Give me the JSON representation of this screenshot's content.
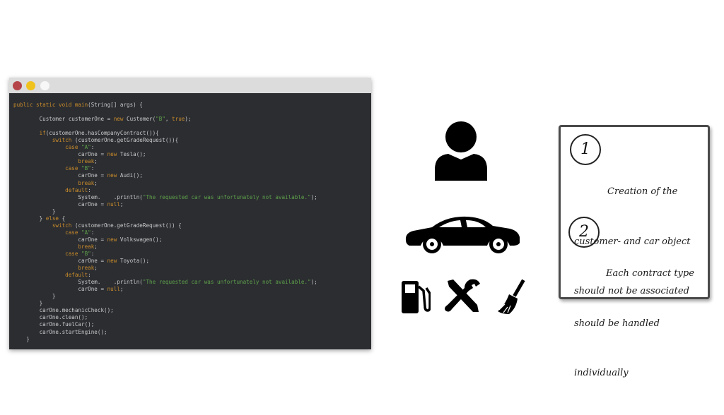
{
  "code_window": {
    "lines": [
      [
        {
          "t": "public static void main",
          "k": "kw"
        },
        {
          "t": "(String[] args) {",
          "k": "plain"
        }
      ],
      [],
      [
        {
          "t": "        Customer customerOne = ",
          "k": "plain"
        },
        {
          "t": "new",
          "k": "kw"
        },
        {
          "t": " Customer(",
          "k": "plain"
        },
        {
          "t": "\"B\"",
          "k": "str"
        },
        {
          "t": ", ",
          "k": "plain"
        },
        {
          "t": "true",
          "k": "kw"
        },
        {
          "t": ");",
          "k": "plain"
        }
      ],
      [],
      [
        {
          "t": "        if",
          "k": "kw"
        },
        {
          "t": "(customerOne.hasCompanyContract()){",
          "k": "plain"
        }
      ],
      [
        {
          "t": "            switch",
          "k": "kw"
        },
        {
          "t": " (customerOne.getGradeRequest()){",
          "k": "plain"
        }
      ],
      [
        {
          "t": "                case ",
          "k": "kw"
        },
        {
          "t": "\"A\"",
          "k": "str"
        },
        {
          "t": ":",
          "k": "plain"
        }
      ],
      [
        {
          "t": "                    carOne = ",
          "k": "plain"
        },
        {
          "t": "new",
          "k": "kw"
        },
        {
          "t": " Tesla();",
          "k": "plain"
        }
      ],
      [
        {
          "t": "                    break",
          "k": "kw"
        },
        {
          "t": ";",
          "k": "plain"
        }
      ],
      [
        {
          "t": "                case ",
          "k": "kw"
        },
        {
          "t": "\"B\"",
          "k": "str"
        },
        {
          "t": ":",
          "k": "plain"
        }
      ],
      [
        {
          "t": "                    carOne = ",
          "k": "plain"
        },
        {
          "t": "new",
          "k": "kw"
        },
        {
          "t": " Audi();",
          "k": "plain"
        }
      ],
      [
        {
          "t": "                    break",
          "k": "kw"
        },
        {
          "t": ";",
          "k": "plain"
        }
      ],
      [
        {
          "t": "                default",
          "k": "kw"
        },
        {
          "t": ":",
          "k": "plain"
        }
      ],
      [
        {
          "t": "                    System.    .println(",
          "k": "plain"
        },
        {
          "t": "\"The requested car was unfortunately not available.\"",
          "k": "str"
        },
        {
          "t": ");",
          "k": "plain"
        }
      ],
      [
        {
          "t": "                    carOne = ",
          "k": "plain"
        },
        {
          "t": "null",
          "k": "kw"
        },
        {
          "t": ";",
          "k": "plain"
        }
      ],
      [
        {
          "t": "            }",
          "k": "plain"
        }
      ],
      [
        {
          "t": "        } ",
          "k": "plain"
        },
        {
          "t": "else",
          "k": "kw"
        },
        {
          "t": " {",
          "k": "plain"
        }
      ],
      [
        {
          "t": "            switch",
          "k": "kw"
        },
        {
          "t": " (customerOne.getGradeRequest()) {",
          "k": "plain"
        }
      ],
      [
        {
          "t": "                case ",
          "k": "kw"
        },
        {
          "t": "\"A\"",
          "k": "str"
        },
        {
          "t": ":",
          "k": "plain"
        }
      ],
      [
        {
          "t": "                    carOne = ",
          "k": "plain"
        },
        {
          "t": "new",
          "k": "kw"
        },
        {
          "t": " Volkswagen();",
          "k": "plain"
        }
      ],
      [
        {
          "t": "                    break",
          "k": "kw"
        },
        {
          "t": ";",
          "k": "plain"
        }
      ],
      [
        {
          "t": "                case ",
          "k": "kw"
        },
        {
          "t": "\"B\"",
          "k": "str"
        },
        {
          "t": ":",
          "k": "plain"
        }
      ],
      [
        {
          "t": "                    carOne = ",
          "k": "plain"
        },
        {
          "t": "new",
          "k": "kw"
        },
        {
          "t": " Toyota();",
          "k": "plain"
        }
      ],
      [
        {
          "t": "                    break",
          "k": "kw"
        },
        {
          "t": ";",
          "k": "plain"
        }
      ],
      [
        {
          "t": "                default",
          "k": "kw"
        },
        {
          "t": ":",
          "k": "plain"
        }
      ],
      [
        {
          "t": "                    System.    .println(",
          "k": "plain"
        },
        {
          "t": "\"The requested car was unfortunately not available.\"",
          "k": "str"
        },
        {
          "t": ");",
          "k": "plain"
        }
      ],
      [
        {
          "t": "                    carOne = ",
          "k": "plain"
        },
        {
          "t": "null",
          "k": "kw"
        },
        {
          "t": ";",
          "k": "plain"
        }
      ],
      [
        {
          "t": "            }",
          "k": "plain"
        }
      ],
      [
        {
          "t": "        }",
          "k": "plain"
        }
      ],
      [
        {
          "t": "        carOne.mechanicCheck();",
          "k": "plain"
        }
      ],
      [
        {
          "t": "        carOne.clean();",
          "k": "plain"
        }
      ],
      [
        {
          "t": "        carOne.fuelCar();",
          "k": "plain"
        }
      ],
      [
        {
          "t": "        carOne.startEngine();",
          "k": "plain"
        }
      ],
      [
        {
          "t": "    }",
          "k": "plain"
        }
      ]
    ]
  },
  "icons": {
    "user": "user-icon",
    "car": "car-icon",
    "fuel": "fuel-pump-icon",
    "tools": "wrench-screwdriver-icon",
    "broom": "broom-icon"
  },
  "note": {
    "item1": {
      "number": "1",
      "lines": [
        "Creation of the",
        "customer- and car object",
        "should not be associated"
      ]
    },
    "item2": {
      "number": "2",
      "lines": [
        "Each contract type",
        "should be handled",
        "individually"
      ]
    }
  },
  "colors": {
    "editor_bg": "#2b2d31",
    "keyword": "#c98b2a",
    "string": "#5fa04a",
    "plain": "#c8c8c8",
    "titlebar_red": "#b4434a",
    "titlebar_yellow": "#f0c21e"
  }
}
